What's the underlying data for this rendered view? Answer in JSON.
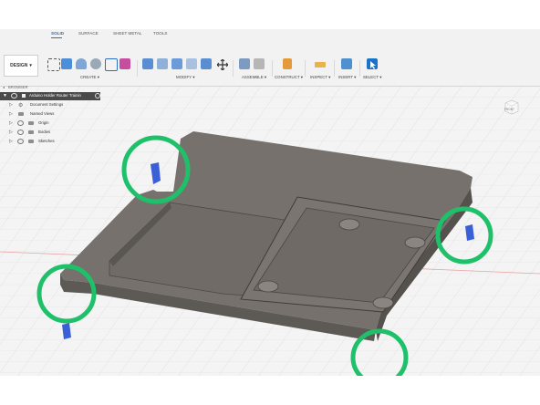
{
  "app": {
    "workspace": "DESIGN",
    "workspace_caret": "▾",
    "tabs": [
      {
        "label": "SOLID",
        "active": true
      },
      {
        "label": "SURFACE",
        "active": false
      },
      {
        "label": "SHEET METAL",
        "active": false
      },
      {
        "label": "TOOLS",
        "active": false
      }
    ],
    "groups": {
      "create": "CREATE ▾",
      "modify": "MODIFY ▾",
      "assemble": "ASSEMBLE ▾",
      "construct": "CONSTRUCT ▾",
      "inspect": "INSPECT ▾",
      "insert": "INSERT ▾",
      "select": "SELECT ▾"
    },
    "icons": [
      "new-component-icon",
      "sketch-icon",
      "extrude-icon",
      "revolve-icon",
      "sweep-icon",
      "pattern-icon",
      "press-pull-icon",
      "fillet-icon",
      "chamfer-icon",
      "shell-icon",
      "align-icon",
      "move-icon",
      "joint-icon",
      "as-built-joint-icon",
      "offset-plane-icon",
      "measure-icon",
      "insert-image-icon",
      "select-arrow-icon"
    ],
    "colors": {
      "accent": "#1a73c8",
      "highlight_circle": "#1fc06a",
      "face_highlight": "#3a5fd6",
      "model_body": "#6e6a66"
    }
  },
  "browser": {
    "header": "BROWSER",
    "root": "Arduino Holder Router Trainin",
    "items": [
      {
        "label": "Document Settings",
        "icon": "gear-icon"
      },
      {
        "label": "Named Views",
        "icon": "folder-icon"
      },
      {
        "label": "Origin",
        "icon": "folder-icon"
      },
      {
        "label": "Bodies",
        "icon": "folder-icon"
      },
      {
        "label": "Sketches",
        "icon": "folder-icon"
      }
    ]
  },
  "viewcube": {
    "label": "FRONT"
  }
}
